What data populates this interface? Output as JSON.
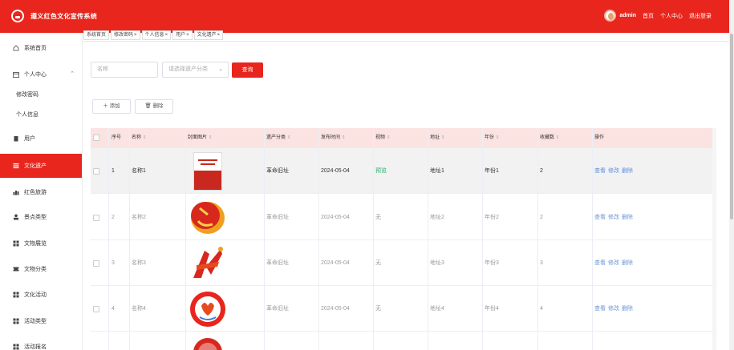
{
  "header": {
    "title": "遵义红色文化宣传系统",
    "user": "admin",
    "nav": [
      "首页",
      "个人中心",
      "退出登录"
    ]
  },
  "sidebar": {
    "items": [
      {
        "label": "系统首页",
        "icon": "home-icon"
      },
      {
        "label": "个人中心",
        "icon": "calendar-icon"
      },
      {
        "label": "修改密码",
        "icon": ""
      },
      {
        "label": "个人信息",
        "icon": ""
      },
      {
        "label": "用户",
        "icon": "clipboard-icon"
      },
      {
        "label": "文化遗产",
        "icon": "list-icon"
      },
      {
        "label": "红色旅游",
        "icon": "chart-icon"
      },
      {
        "label": "景点类型",
        "icon": "person-icon"
      },
      {
        "label": "文物展览",
        "icon": "grid-icon"
      },
      {
        "label": "文物分类",
        "icon": "ticket-icon"
      },
      {
        "label": "文化活动",
        "icon": "grid-icon"
      },
      {
        "label": "活动类型",
        "icon": "grid-icon"
      },
      {
        "label": "活动报名",
        "icon": "grid-icon"
      }
    ]
  },
  "tabs": [
    "系统首页",
    "修改密码",
    "个人信息",
    "用户",
    "文化遗产"
  ],
  "search": {
    "name_placeholder": "名称",
    "category_placeholder": "请选择遗产分类",
    "search_label": "查询"
  },
  "toolbar": {
    "add_label": "添加",
    "delete_label": "删除"
  },
  "table": {
    "headers": [
      "序号",
      "名称",
      "封面图片",
      "遗产分类",
      "发布时间",
      "视频",
      "地址",
      "年份",
      "收藏数",
      "操作"
    ],
    "rows": [
      {
        "index": "1",
        "name": "名称1",
        "category": "革命旧址",
        "date": "2024-05-04",
        "video": "预览",
        "address": "地址1",
        "year": "年份1",
        "favorites": "2",
        "ops": [
          "查看",
          "修改",
          "删除"
        ]
      },
      {
        "index": "2",
        "name": "名称2",
        "category": "革命旧址",
        "date": "2024-05-04",
        "video": "无",
        "address": "地址2",
        "year": "年份2",
        "favorites": "2",
        "ops": [
          "查看",
          "修改",
          "删除"
        ]
      },
      {
        "index": "3",
        "name": "名称3",
        "category": "革命旧址",
        "date": "2024-05-04",
        "video": "无",
        "address": "地址3",
        "year": "年份3",
        "favorites": "3",
        "ops": [
          "查看",
          "修改",
          "删除"
        ]
      },
      {
        "index": "4",
        "name": "名称4",
        "category": "革命旧址",
        "date": "2024-05-04",
        "video": "无",
        "address": "地址4",
        "year": "年份4",
        "favorites": "4",
        "ops": [
          "查看",
          "修改",
          "删除"
        ]
      }
    ]
  },
  "colors": {
    "primary": "#e8261d",
    "header_row": "#fbe3e2",
    "link": "#3f7fe0"
  }
}
